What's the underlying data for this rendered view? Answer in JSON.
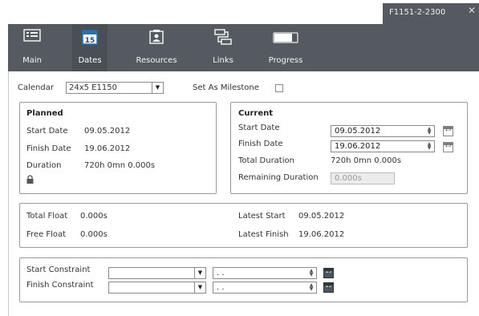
{
  "window": {
    "tab_title": "F1151-2-2300"
  },
  "ribbon": {
    "tabs": [
      {
        "label": "Main",
        "icon": "main-icon"
      },
      {
        "label": "Dates",
        "icon": "calendar-icon",
        "badge": "15",
        "active": true
      },
      {
        "label": "Resources",
        "icon": "resources-icon"
      },
      {
        "label": "Links",
        "icon": "links-icon"
      },
      {
        "label": "Progress",
        "icon": "progress-icon"
      }
    ]
  },
  "calendar": {
    "label": "Calendar",
    "value": "24x5 E1150",
    "milestone_label": "Set As Milestone",
    "milestone_checked": false
  },
  "planned": {
    "title": "Planned",
    "start_label": "Start Date",
    "start_value": "09.05.2012",
    "finish_label": "Finish Date",
    "finish_value": "19.06.2012",
    "duration_label": "Duration",
    "duration_value": "720h 0mn 0.000s"
  },
  "current": {
    "title": "Current",
    "start_label": "Start Date",
    "start_value": "09.05.2012",
    "finish_label": "Finish Date",
    "finish_value": "19.06.2012",
    "total_duration_label": "Total Duration",
    "total_duration_value": "720h 0mn 0.000s",
    "remaining_label": "Remaining Duration",
    "remaining_value": "0.000s"
  },
  "float": {
    "total_float_label": "Total Float",
    "total_float_value": "0.000s",
    "free_float_label": "Free Float",
    "free_float_value": "0.000s",
    "latest_start_label": "Latest Start",
    "latest_start_value": "09.05.2012",
    "latest_finish_label": "Latest Finish",
    "latest_finish_value": "19.06.2012"
  },
  "constraints": {
    "start_label": "Start Constraint",
    "start_type": "",
    "start_date": ". .",
    "finish_label": "Finish Constraint",
    "finish_type": "",
    "finish_date": ". ."
  },
  "calendar_icon_text": "15"
}
